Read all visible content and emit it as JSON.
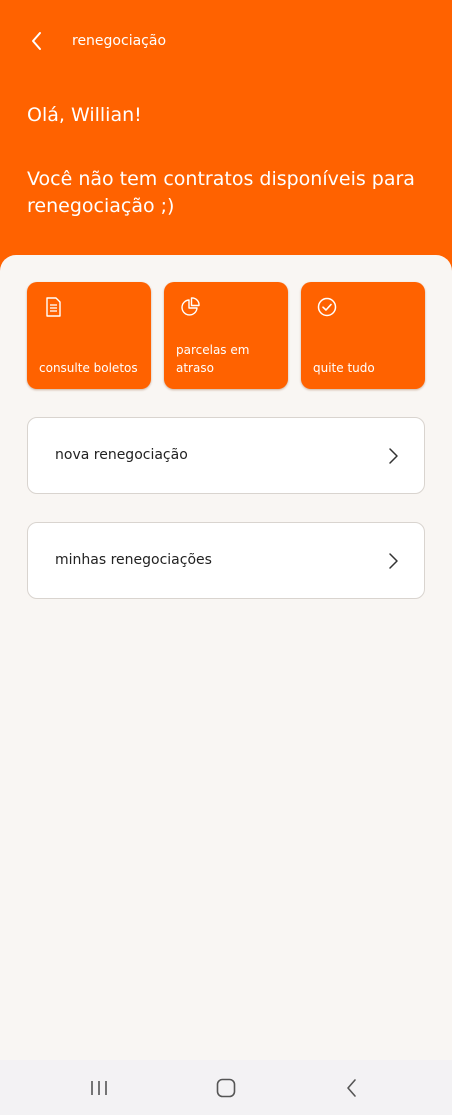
{
  "header": {
    "back_icon": "chevron-left-icon",
    "title": "renegociação",
    "greeting": "Olá, Willian!",
    "message": "Você não tem contratos disponíveis para renegociação ;)",
    "background_color": "#ff6200"
  },
  "shortcuts": [
    {
      "label": "consulte boletos",
      "icon": "document-icon"
    },
    {
      "label": "parcelas em atraso",
      "icon": "pie-chart-icon"
    },
    {
      "label": "quite tudo",
      "icon": "check-circle-icon"
    }
  ],
  "menu": [
    {
      "label": "nova renegociação",
      "icon": "chevron-right-icon"
    },
    {
      "label": "minhas renegociações",
      "icon": "chevron-right-icon"
    }
  ],
  "system_nav": {
    "recent_icon": "recent-apps-icon",
    "home_icon": "home-icon",
    "back_icon": "back-icon"
  },
  "colors": {
    "accent": "#ff6200",
    "background": "#f9f6f3",
    "card": "#ffffff",
    "text": "#222222"
  }
}
